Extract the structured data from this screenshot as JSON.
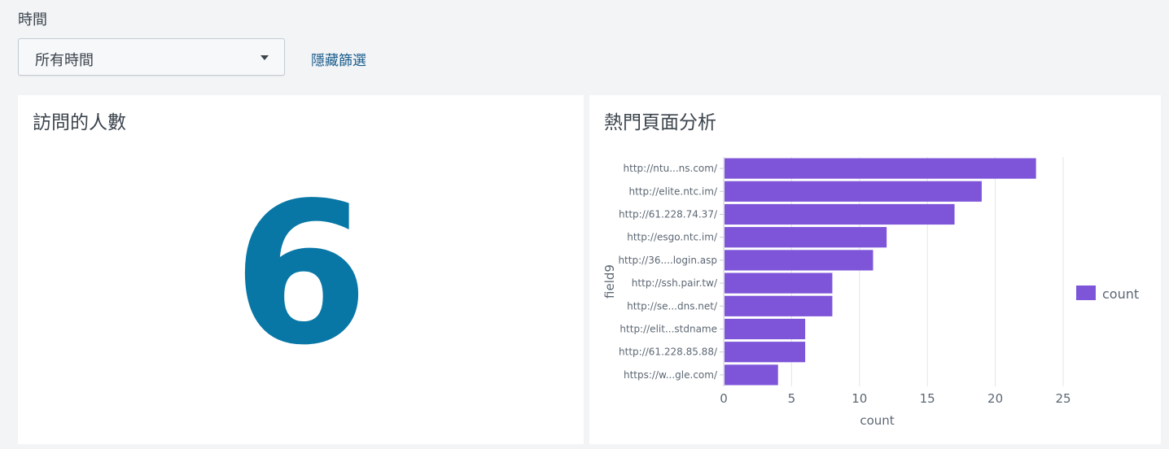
{
  "filter": {
    "label": "時間",
    "time_select_value": "所有時間",
    "hide_filters_link": "隱藏篩選"
  },
  "panels": {
    "visitors": {
      "title": "訪問的人數",
      "value": "6",
      "value_color": "#0877a6"
    },
    "top_pages": {
      "title": "熱門頁面分析"
    }
  },
  "chart_data": {
    "type": "bar",
    "orientation": "horizontal",
    "categories": [
      "http://ntu...ns.com/",
      "http://elite.ntc.im/",
      "http://61.228.74.37/",
      "http://esgo.ntc.im/",
      "http://36....login.asp",
      "http://ssh.pair.tw/",
      "http://se...dns.net/",
      "http://elit...stdname",
      "http://61.228.85.88/",
      "https://w...gle.com/"
    ],
    "series": [
      {
        "name": "count",
        "values": [
          23,
          19,
          17,
          12,
          11,
          8,
          8,
          6,
          6,
          4
        ],
        "color": "#7e55d9"
      }
    ],
    "xlabel": "count",
    "ylabel": "field9",
    "xlim": [
      0,
      25
    ],
    "xticks": [
      "0",
      "5",
      "10",
      "15",
      "20",
      "25"
    ],
    "grid": true,
    "legend_position": "right"
  }
}
